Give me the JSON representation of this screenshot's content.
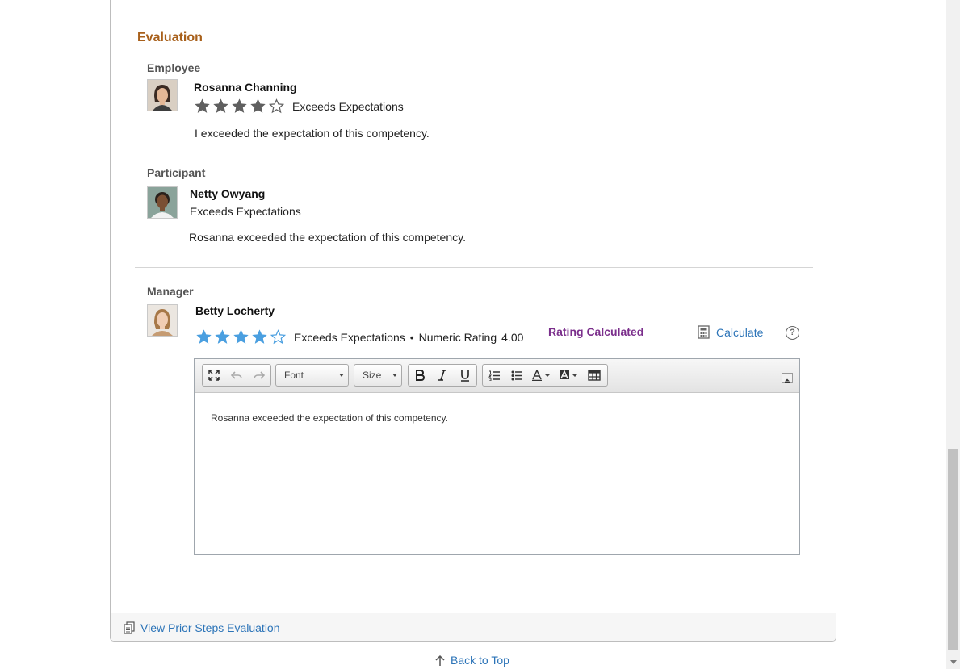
{
  "section_title": "Evaluation",
  "employee": {
    "role": "Employee",
    "name": "Rosanna Channing",
    "stars_filled": 4,
    "stars_total": 5,
    "rating_text": "Exceeds Expectations",
    "comment": "I exceeded the expectation of this competency."
  },
  "participant": {
    "role": "Participant",
    "name": "Netty Owyang",
    "rating_text": "Exceeds Expectations",
    "comment": "Rosanna exceeded the expectation of this competency."
  },
  "manager": {
    "role": "Manager",
    "name": "Betty Locherty",
    "stars_filled": 4,
    "stars_total": 5,
    "rating_text": "Exceeds Expectations",
    "bullet": "•",
    "numeric_label": "Numeric Rating",
    "numeric_value": "4.00",
    "status": "Rating Calculated",
    "calculate_label": "Calculate",
    "help_symbol": "?"
  },
  "editor": {
    "font_combo": "Font",
    "size_combo": "Size",
    "content": "Rosanna exceeded the expectation of this competency.",
    "toolbar_icons": [
      "maximize-icon",
      "undo-icon",
      "redo-icon",
      "bold-icon",
      "italic-icon",
      "underline-icon",
      "numbered-list-icon",
      "bulleted-list-icon",
      "text-color-icon",
      "background-color-icon",
      "table-icon",
      "collapse-icon"
    ]
  },
  "footer": {
    "prior_link": "View Prior Steps Evaluation"
  },
  "back_to_top": "Back to Top",
  "colors": {
    "section_title": "#a8601b",
    "employee_star": "#5f5f5f",
    "manager_star": "#4a9fe0",
    "status": "#7b2f8c",
    "link": "#2c74b8"
  }
}
